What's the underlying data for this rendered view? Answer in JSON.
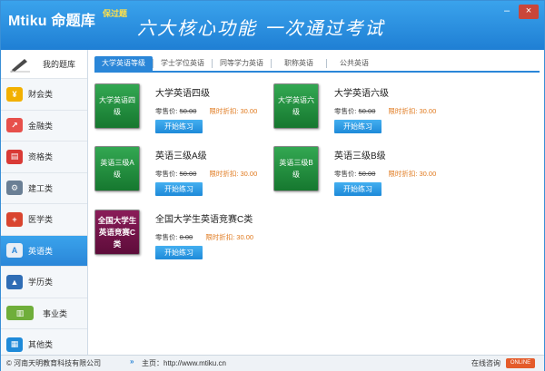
{
  "header": {
    "logo": "Mtiku 命题库",
    "badge": "保过题",
    "slogan": "六大核心功能  一次通过考试",
    "minimize": "–",
    "close": "×"
  },
  "sidebar": {
    "items": [
      {
        "label": "我的题库",
        "icon": "pencil-icon",
        "color": "#ffffff"
      },
      {
        "label": "财会类",
        "icon": "coin-icon",
        "color": "#f2b000"
      },
      {
        "label": "金融类",
        "icon": "finance-icon",
        "color": "#e7504b"
      },
      {
        "label": "资格类",
        "icon": "certificate-icon",
        "color": "#d93a36"
      },
      {
        "label": "建工类",
        "icon": "gear-icon",
        "color": "#6a7f95"
      },
      {
        "label": "医学类",
        "icon": "medical-kit-icon",
        "color": "#d9452f"
      },
      {
        "label": "英语类",
        "icon": "language-icon",
        "color": "#ffffff"
      },
      {
        "label": "学历类",
        "icon": "graduation-cap-icon",
        "color": "#2f6db5"
      },
      {
        "label": "事业类",
        "icon": "books-icon",
        "color": "#6fae3a"
      },
      {
        "label": "其他类",
        "icon": "grid-icon",
        "color": "#1e8ad9"
      }
    ]
  },
  "tabs": [
    "大学英语等级",
    "学士学位英语",
    "同等学力英语",
    "职称英语",
    "公共英语"
  ],
  "cards": [
    {
      "cover": "大学英语四级",
      "title": "大学英语四级",
      "price_label": "零售价:",
      "old_price": "50.00",
      "discount_label": "限时折扣:",
      "discount": "30.00",
      "button": "开始练习"
    },
    {
      "cover": "大学英语六级",
      "title": "大学英语六级",
      "price_label": "零售价:",
      "old_price": "50.00",
      "discount_label": "限时折扣:",
      "discount": "30.00",
      "button": "开始练习"
    },
    {
      "cover": "英语三级A级",
      "title": "英语三级A级",
      "price_label": "零售价:",
      "old_price": "50.00",
      "discount_label": "限时折扣:",
      "discount": "30.00",
      "button": "开始练习"
    },
    {
      "cover": "英语三级B级",
      "title": "英语三级B级",
      "price_label": "零售价:",
      "old_price": "50.00",
      "discount_label": "限时折扣:",
      "discount": "30.00",
      "button": "开始练习"
    },
    {
      "cover": "全国大学生英语竞赛C类",
      "title": "全国大学生英语竞赛C类",
      "price_label": "零售价:",
      "old_price": "0.00",
      "discount_label": "限时折扣:",
      "discount": "30.00",
      "button": "开始练习"
    }
  ],
  "footer": {
    "copyright": "© 河南天明教育科技有限公司",
    "home": "主页：http://www.mtiku.cn",
    "consult": "在线咨询",
    "online": "ONLINE"
  }
}
